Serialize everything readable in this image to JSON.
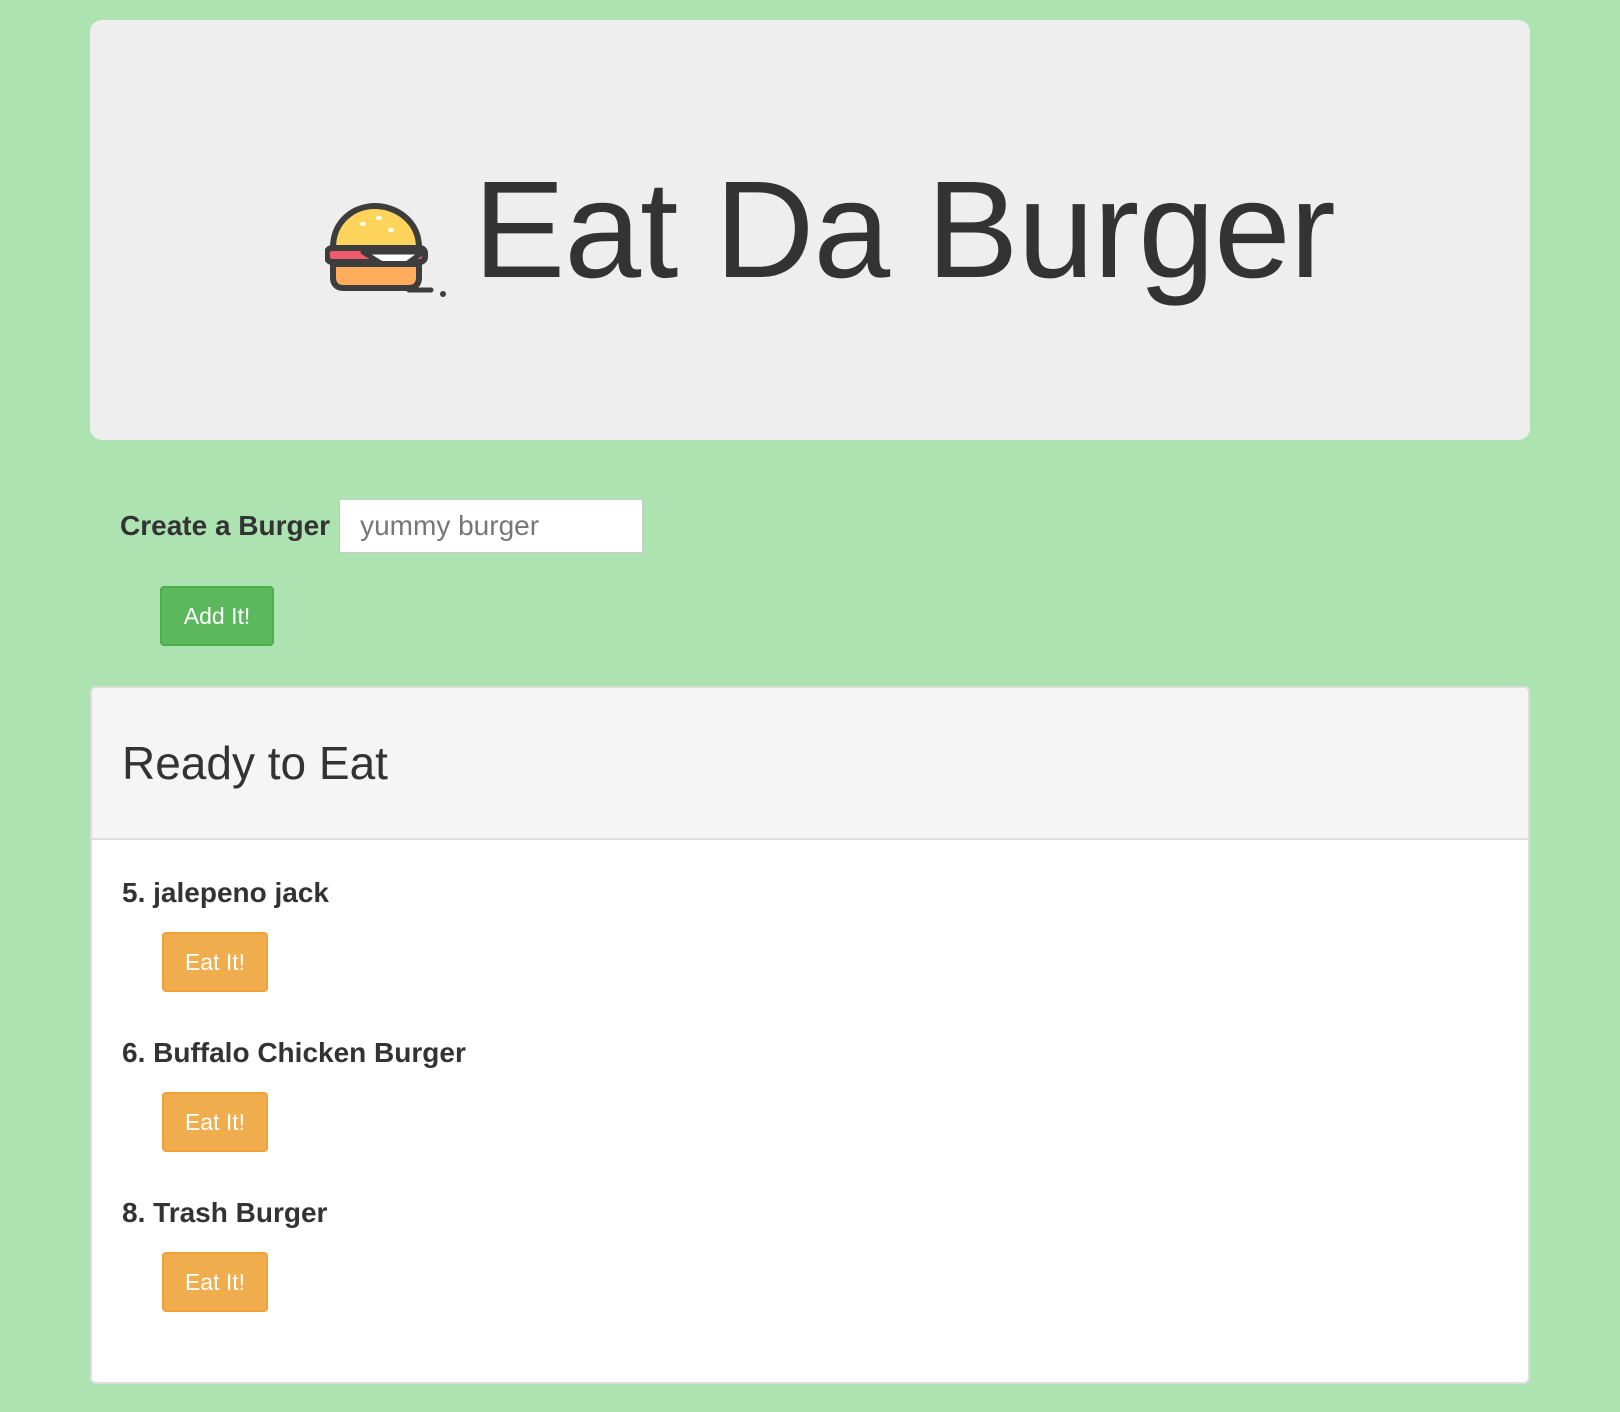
{
  "header": {
    "title": "Eat Da Burger",
    "icon": "burger-icon"
  },
  "create_form": {
    "label": "Create a Burger",
    "input_value": "",
    "input_placeholder": "yummy burger",
    "add_button_label": "Add It!"
  },
  "ready_panel": {
    "title": "Ready to Eat",
    "items": [
      {
        "name": "5. jalepeno jack",
        "button_label": "Eat It!"
      },
      {
        "name": "6. Buffalo Chicken Burger",
        "button_label": "Eat It!"
      },
      {
        "name": "8. Trash Burger",
        "button_label": "Eat It!"
      }
    ]
  },
  "colors": {
    "page_background": "#ade2b1",
    "jumbotron_background": "#eeeeee",
    "add_button": "#5cb85c",
    "eat_button": "#f0ad4e",
    "text": "#333333"
  }
}
